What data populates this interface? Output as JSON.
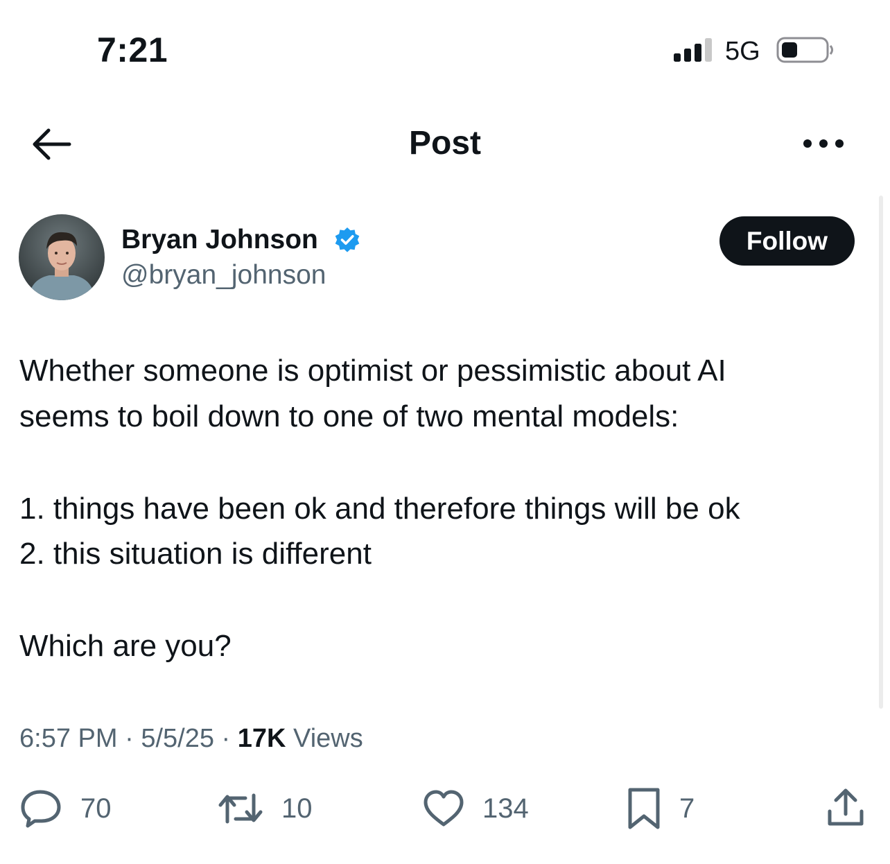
{
  "status_bar": {
    "time": "7:21",
    "network": "5G",
    "signal_bars": 3,
    "signal_bars_total": 4,
    "battery_level": 0.2
  },
  "header": {
    "title": "Post",
    "back_icon": "arrow-left-icon",
    "more_icon": "more-horizontal-icon"
  },
  "author": {
    "name": "Bryan Johnson",
    "handle": "@bryan_johnson",
    "verified": true,
    "verified_color": "#1d9bf0",
    "follow_label": "Follow"
  },
  "post": {
    "lines": [
      "Whether someone is optimist or pessimistic about AI",
      "seems to boil down to one of two mental models:",
      "1. things have been ok and therefore things will be ok",
      "2. this situation is different",
      "Which are you?"
    ]
  },
  "meta": {
    "time": "6:57 PM",
    "date": "5/5/25",
    "views_count": "17K",
    "views_label": "Views",
    "separator": "·"
  },
  "actions": {
    "replies": "70",
    "reposts": "10",
    "likes": "134",
    "bookmarks": "7"
  }
}
